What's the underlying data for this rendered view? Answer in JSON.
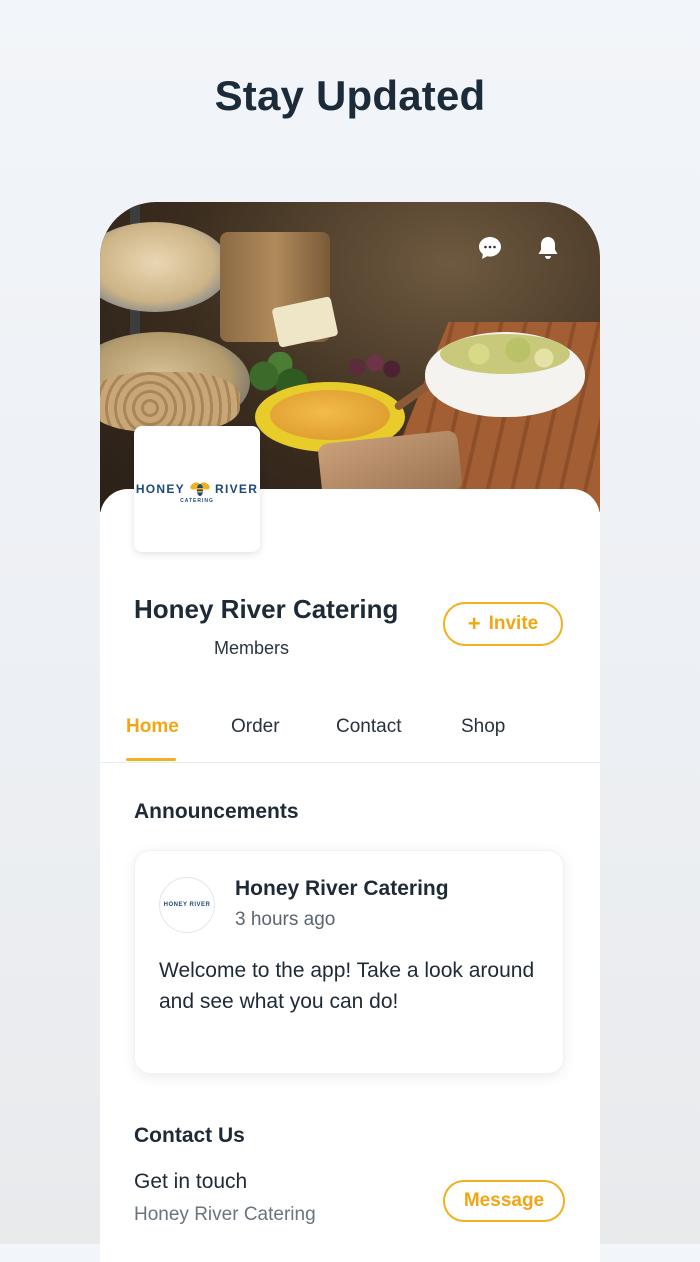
{
  "headline": "Stay Updated",
  "group": {
    "logo_text_left": "HONEY",
    "logo_text_right": "RIVER",
    "logo_subtext": "CATERING",
    "name": "Honey River Catering",
    "members_label": "Members",
    "invite_label": "Invite",
    "invite_icon": "+"
  },
  "tabs": [
    {
      "label": "Home",
      "active": true
    },
    {
      "label": "Order",
      "active": false
    },
    {
      "label": "Contact",
      "active": false
    },
    {
      "label": "Shop",
      "active": false
    }
  ],
  "announcements": {
    "title": "Announcements",
    "post": {
      "author": "Honey River Catering",
      "time": "3 hours ago",
      "body": "Welcome to the app! Take a look around and see what you can do!"
    }
  },
  "contact": {
    "title": "Contact Us",
    "line": "Get in touch",
    "sub": "Honey River Catering",
    "message_label": "Message"
  },
  "icons": {
    "chat": "chat-bubble-icon",
    "bell": "bell-icon"
  },
  "colors": {
    "accent": "#f2b01e",
    "text": "#1f2a37",
    "logo": "#1c4a7a"
  }
}
